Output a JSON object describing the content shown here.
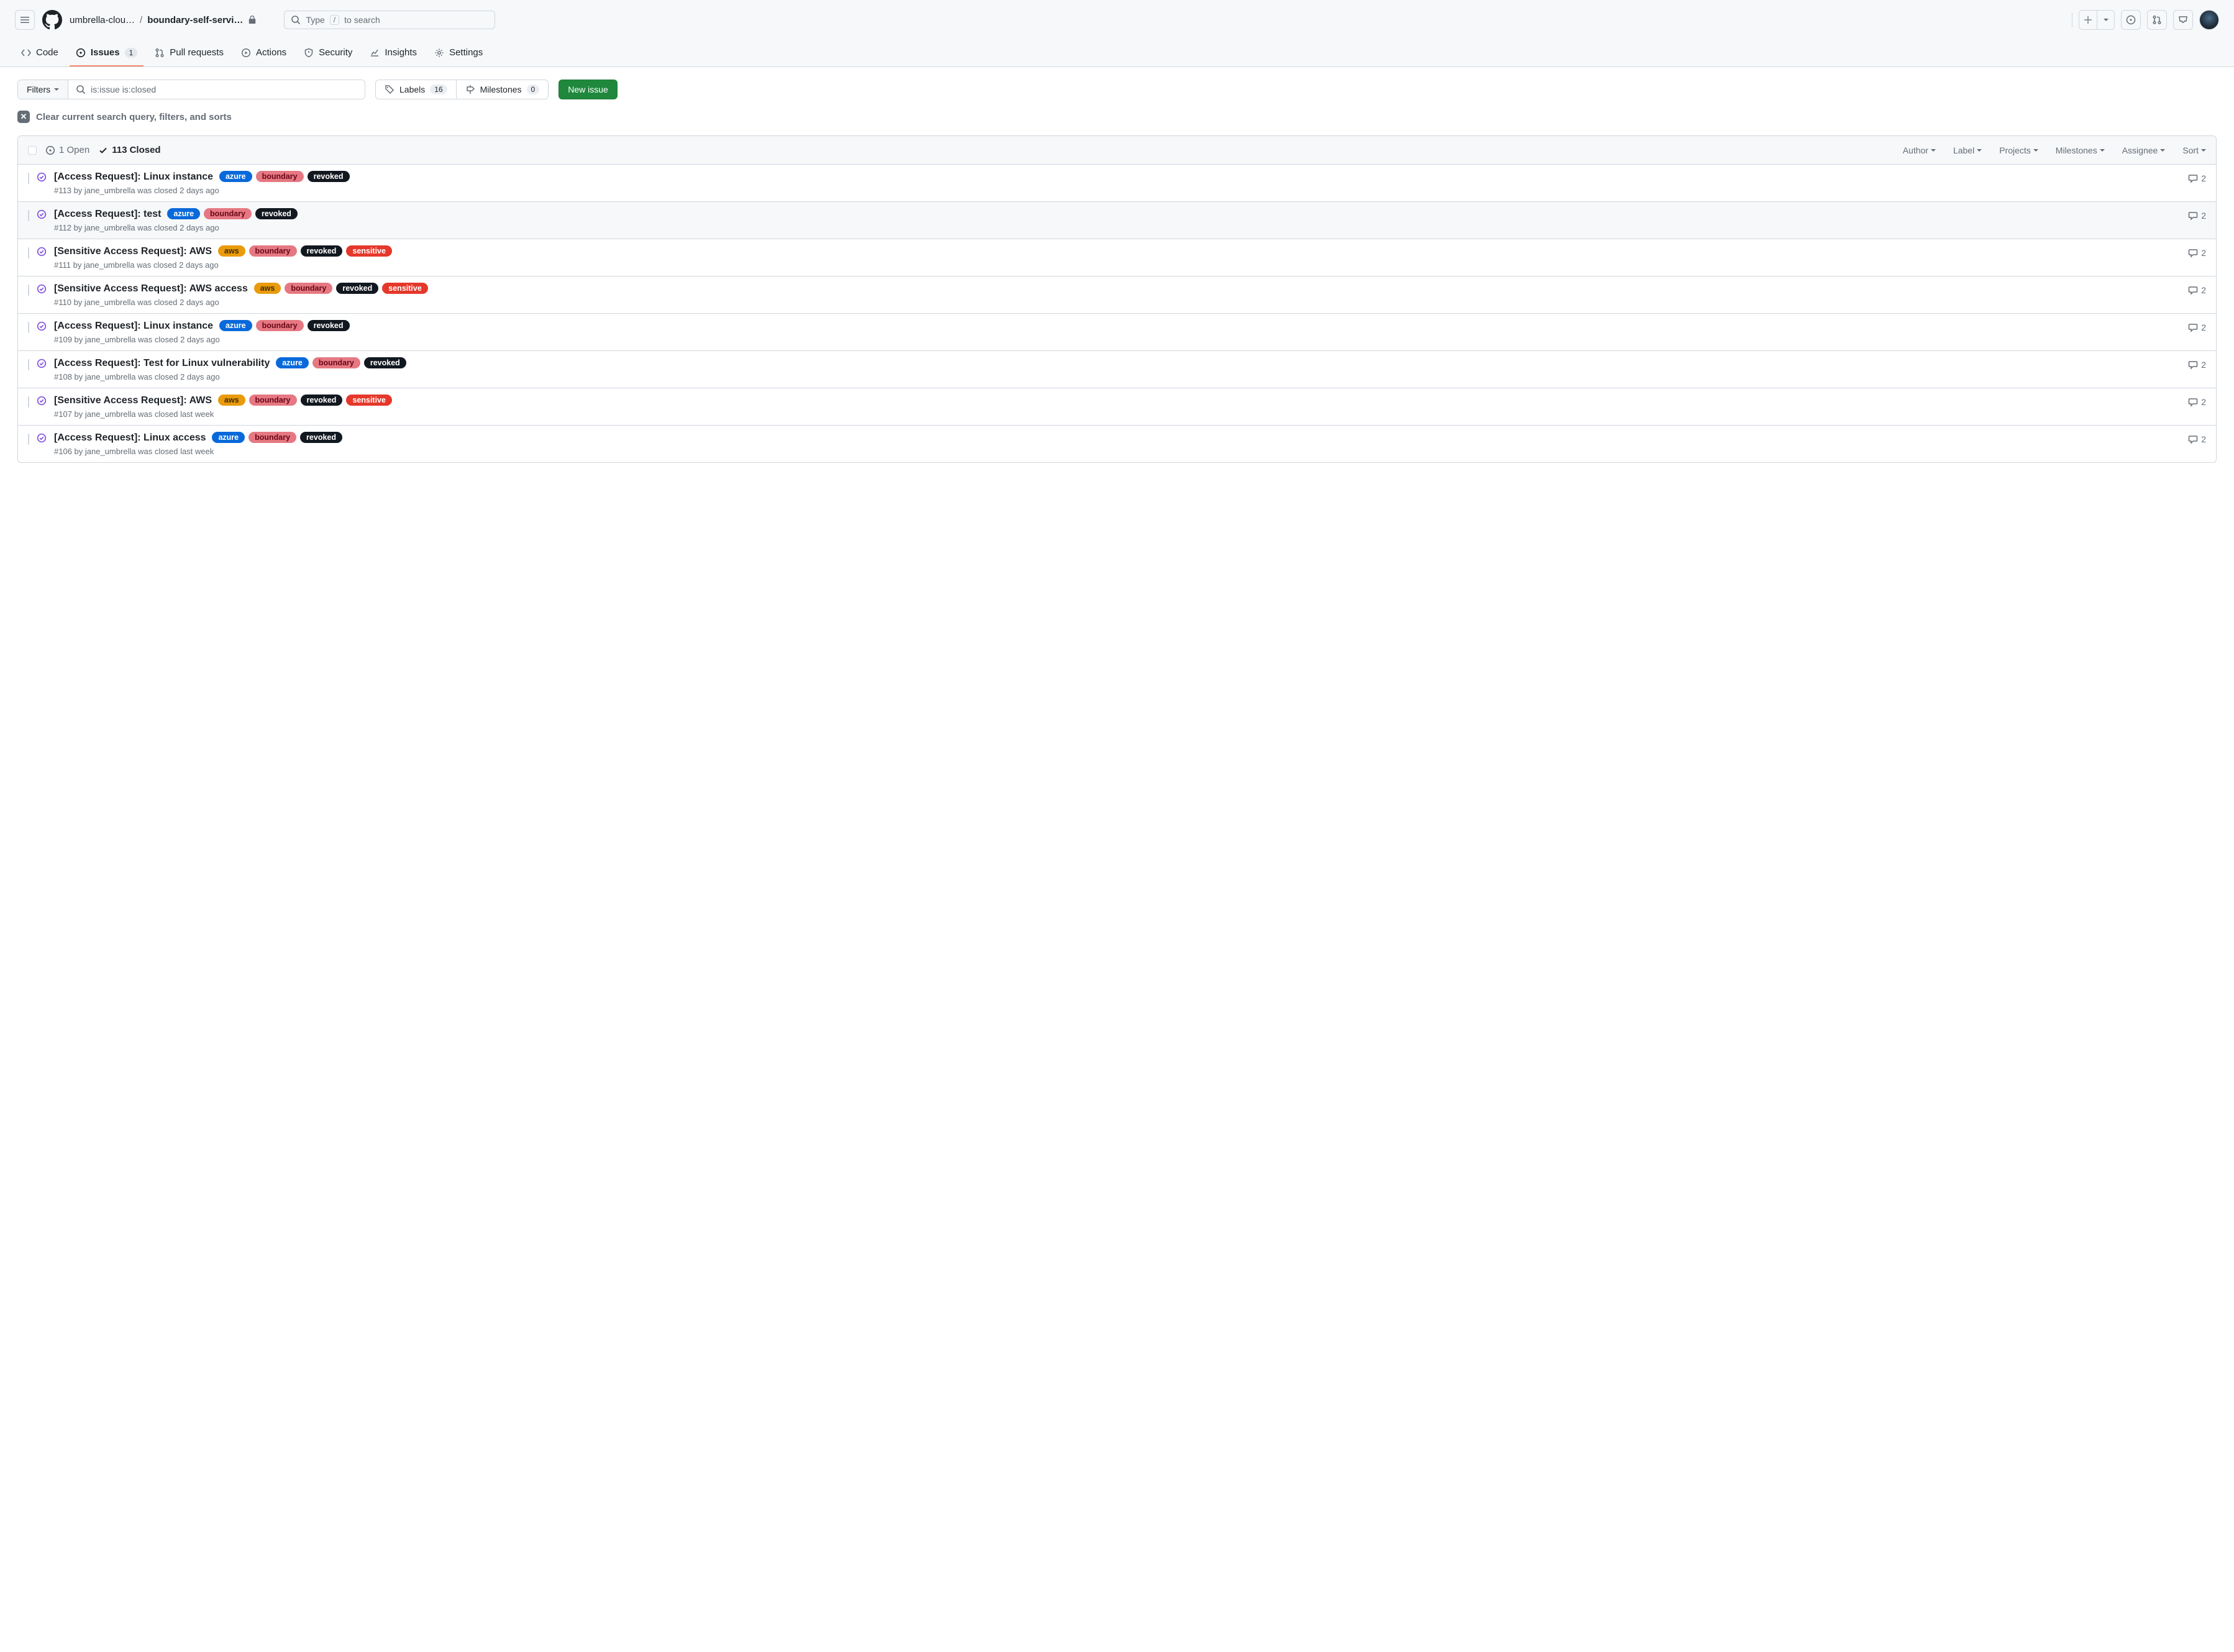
{
  "header": {
    "owner": "umbrella-clou…",
    "repo": "boundary-self-servi…",
    "search_pre": "Type",
    "search_key": "/",
    "search_post": "to search"
  },
  "nav": {
    "code": "Code",
    "issues": "Issues",
    "issues_count": "1",
    "pull_requests": "Pull requests",
    "actions": "Actions",
    "security": "Security",
    "insights": "Insights",
    "settings": "Settings"
  },
  "controls": {
    "filters_label": "Filters",
    "query": "is:issue is:closed",
    "labels_label": "Labels",
    "labels_count": "16",
    "milestones_label": "Milestones",
    "milestones_count": "0",
    "new_issue": "New issue",
    "clear_text": "Clear current search query, filters, and sorts"
  },
  "list_header": {
    "open": "1 Open",
    "closed": "113 Closed",
    "author": "Author",
    "label": "Label",
    "projects": "Projects",
    "milestones": "Milestones",
    "assignee": "Assignee",
    "sort": "Sort"
  },
  "label_styles": {
    "azure": {
      "bg": "#0969da",
      "fg": "#ffffff"
    },
    "aws": {
      "bg": "#e99b0c",
      "fg": "#412b00"
    },
    "boundary": {
      "bg": "#e57882",
      "fg": "#6a0615"
    },
    "revoked": {
      "bg": "#12181f",
      "fg": "#ffffff"
    },
    "sensitive": {
      "bg": "#e5382b",
      "fg": "#ffffff"
    }
  },
  "issues": [
    {
      "title": "[Access Request]: Linux instance",
      "labels": [
        "azure",
        "boundary",
        "revoked"
      ],
      "meta": "#113 by jane_umbrella was closed 2 days ago",
      "comments": "2",
      "hovered": false
    },
    {
      "title": "[Access Request]: test",
      "labels": [
        "azure",
        "boundary",
        "revoked"
      ],
      "meta": "#112 by jane_umbrella was closed 2 days ago",
      "comments": "2",
      "hovered": true
    },
    {
      "title": "[Sensitive Access Request]: AWS",
      "labels": [
        "aws",
        "boundary",
        "revoked",
        "sensitive"
      ],
      "meta": "#111 by jane_umbrella was closed 2 days ago",
      "comments": "2",
      "hovered": false
    },
    {
      "title": "[Sensitive Access Request]: AWS access",
      "labels": [
        "aws",
        "boundary",
        "revoked",
        "sensitive"
      ],
      "meta": "#110 by jane_umbrella was closed 2 days ago",
      "comments": "2",
      "hovered": false
    },
    {
      "title": "[Access Request]: Linux instance",
      "labels": [
        "azure",
        "boundary",
        "revoked"
      ],
      "meta": "#109 by jane_umbrella was closed 2 days ago",
      "comments": "2",
      "hovered": false
    },
    {
      "title": "[Access Request]: Test for Linux vulnerability",
      "labels": [
        "azure",
        "boundary",
        "revoked"
      ],
      "meta": "#108 by jane_umbrella was closed 2 days ago",
      "comments": "2",
      "hovered": false
    },
    {
      "title": "[Sensitive Access Request]: AWS",
      "labels": [
        "aws",
        "boundary",
        "revoked",
        "sensitive"
      ],
      "meta": "#107 by jane_umbrella was closed last week",
      "comments": "2",
      "hovered": false
    },
    {
      "title": "[Access Request]: Linux access",
      "labels": [
        "azure",
        "boundary",
        "revoked"
      ],
      "meta": "#106 by jane_umbrella was closed last week",
      "comments": "2",
      "hovered": false
    }
  ]
}
